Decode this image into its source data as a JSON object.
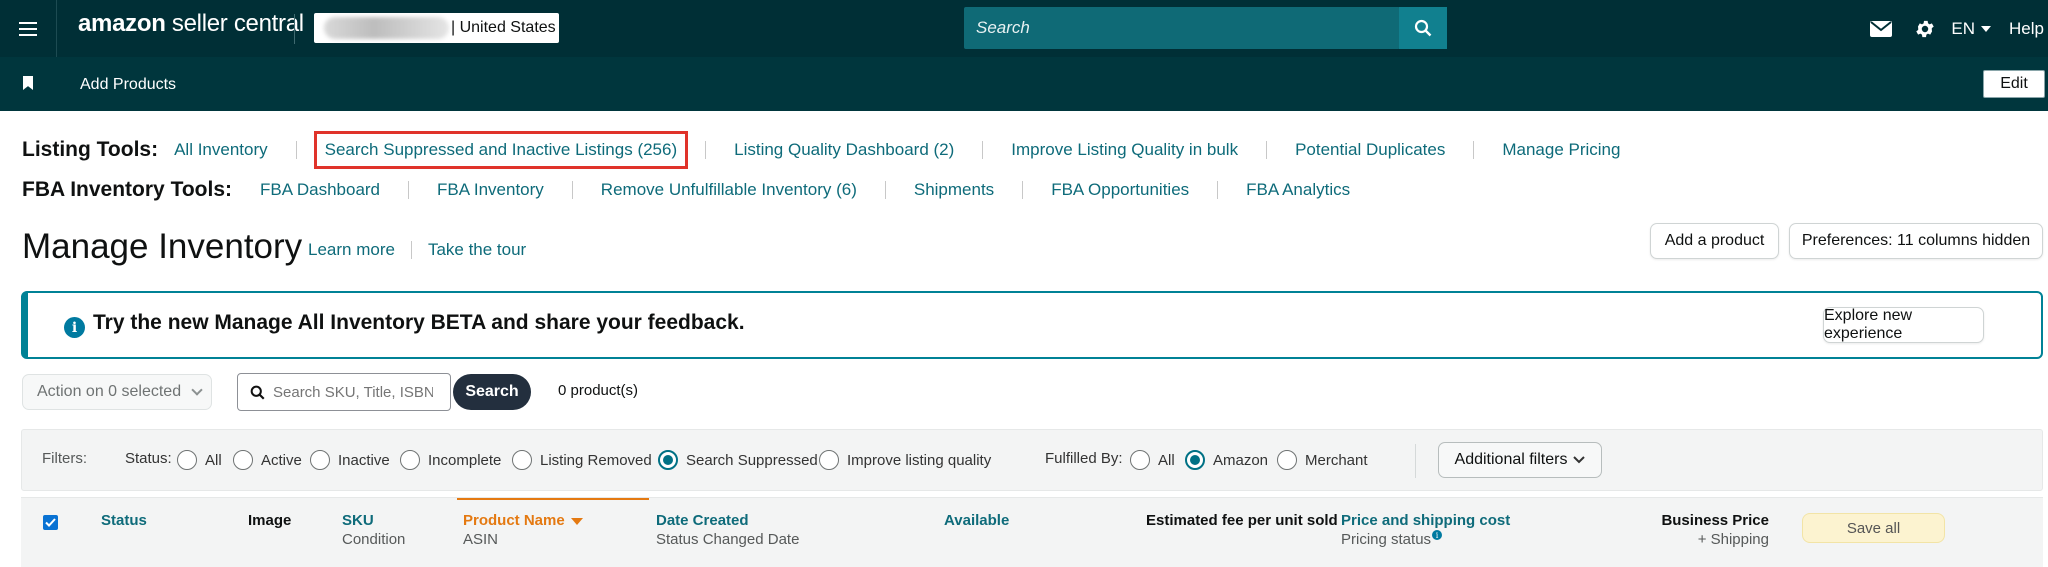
{
  "topbar": {
    "logo_bold": "amazon",
    "logo_rest": " seller central",
    "store_suffix": "| United States",
    "search_placeholder": "Search",
    "lang": "EN",
    "help": "Help"
  },
  "subbar": {
    "bookmark_label": "Add Products",
    "edit_label": "Edit"
  },
  "listing_tools": {
    "title": "Listing Tools:",
    "links": [
      "All Inventory",
      "Search Suppressed and Inactive Listings (256)",
      "Listing Quality Dashboard (2)",
      "Improve Listing Quality in bulk",
      "Potential Duplicates",
      "Manage Pricing"
    ]
  },
  "fba_tools": {
    "title": "FBA Inventory Tools:",
    "links": [
      "FBA Dashboard",
      "FBA Inventory",
      "Remove Unfulfillable Inventory (6)",
      "Shipments",
      "FBA Opportunities",
      "FBA Analytics"
    ]
  },
  "page": {
    "title": "Manage Inventory",
    "learn_more": "Learn more",
    "take_tour": "Take the tour",
    "add_product": "Add a product",
    "preferences": "Preferences: 11 columns hidden"
  },
  "banner": {
    "text": "Try the new Manage All Inventory BETA and share your feedback.",
    "button": "Explore new experience"
  },
  "actions": {
    "action_select": "Action on 0 selected",
    "search_placeholder": "Search SKU, Title, ISBN",
    "search_button": "Search",
    "product_count": "0 product(s)"
  },
  "filters": {
    "label": "Filters:",
    "status_label": "Status:",
    "status_options": [
      "All",
      "Active",
      "Inactive",
      "Incomplete",
      "Listing Removed",
      "Search Suppressed",
      "Improve listing quality"
    ],
    "status_selected": "Search Suppressed",
    "fulfilled_label": "Fulfilled By:",
    "fulfilled_options": [
      "All",
      "Amazon",
      "Merchant"
    ],
    "fulfilled_selected": "Amazon",
    "additional": "Additional filters"
  },
  "table_header": {
    "status": "Status",
    "image": "Image",
    "sku": "SKU",
    "condition": "Condition",
    "product_name": "Product Name",
    "asin": "ASIN",
    "date_created": "Date Created",
    "status_changed": "Status Changed Date",
    "available": "Available",
    "est_fee": "Estimated fee per unit sold",
    "price": "Price and shipping cost",
    "pricing_status": "Pricing status",
    "business_price": "Business Price",
    "plus_shipping": "+ Shipping",
    "save_all": "Save all"
  }
}
